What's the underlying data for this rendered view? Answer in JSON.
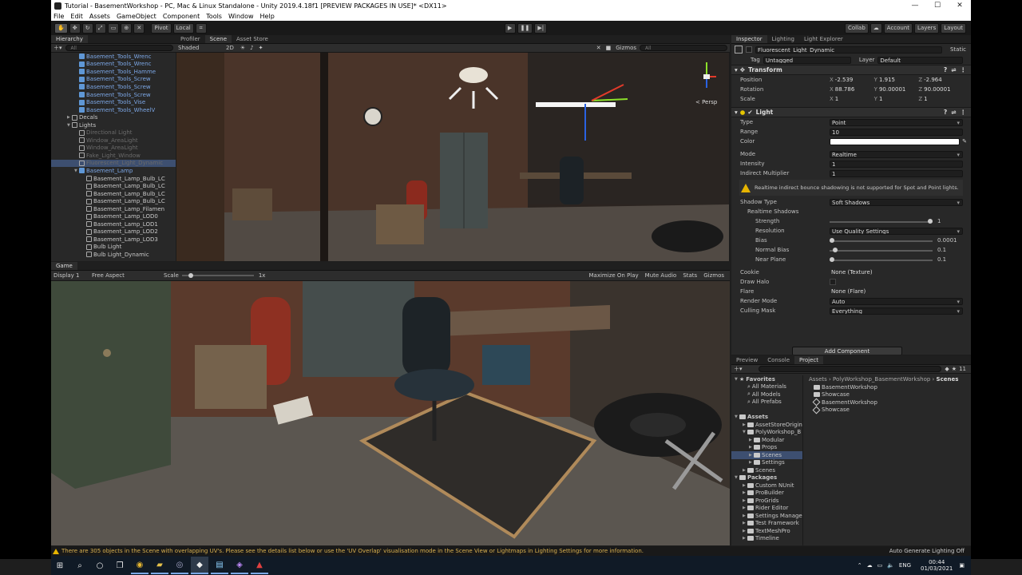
{
  "window": {
    "title": "Tutorial - BasementWorkshop - PC, Mac & Linux Standalone - Unity 2019.4.18f1 [PREVIEW PACKAGES IN USE]* <DX11>",
    "minimize": "—",
    "maximize": "☐",
    "close": "✕"
  },
  "menu": [
    "File",
    "Edit",
    "Assets",
    "GameObject",
    "Component",
    "Tools",
    "Window",
    "Help"
  ],
  "toolbar": {
    "pivot": "Pivot",
    "local": "Local",
    "collab": "Collab",
    "account": "Account",
    "layers": "Layers",
    "layout": "Layout"
  },
  "hierarchy": {
    "tab": "Hierarchy",
    "search_placeholder": "All",
    "items": [
      {
        "label": "Basement_Tools_Wrenc",
        "kind": "prefab",
        "indent": 3
      },
      {
        "label": "Basement_Tools_Wrenc",
        "kind": "prefab",
        "indent": 3
      },
      {
        "label": "Basement_Tools_Hamme",
        "kind": "prefab",
        "indent": 3
      },
      {
        "label": "Basement_Tools_Screw",
        "kind": "prefab",
        "indent": 3
      },
      {
        "label": "Basement_Tools_Screw",
        "kind": "prefab",
        "indent": 3
      },
      {
        "label": "Basement_Tools_Screw",
        "kind": "prefab",
        "indent": 3
      },
      {
        "label": "Basement_Tools_Vise",
        "kind": "prefab",
        "indent": 3
      },
      {
        "label": "Basement_Tools_WheelV",
        "kind": "prefab",
        "indent": 3
      },
      {
        "label": "Decals",
        "kind": "normal",
        "indent": 2
      },
      {
        "label": "Lights",
        "kind": "normal",
        "indent": 2
      },
      {
        "label": "Directional Light",
        "kind": "dim",
        "indent": 3
      },
      {
        "label": "Window_AreaLight",
        "kind": "dim",
        "indent": 3
      },
      {
        "label": "Window_AreaLight",
        "kind": "dim",
        "indent": 3
      },
      {
        "label": "Fake_Light_Window",
        "kind": "dim",
        "indent": 3
      },
      {
        "label": "Fluorescent_Light_Dynamic",
        "kind": "selected",
        "indent": 3
      },
      {
        "label": "Basement_Lamp",
        "kind": "prefab",
        "indent": 3
      },
      {
        "label": "Basement_Lamp_Bulb_LC",
        "kind": "normal",
        "indent": 4
      },
      {
        "label": "Basement_Lamp_Bulb_LC",
        "kind": "normal",
        "indent": 4
      },
      {
        "label": "Basement_Lamp_Bulb_LC",
        "kind": "normal",
        "indent": 4
      },
      {
        "label": "Basement_Lamp_Bulb_LC",
        "kind": "normal",
        "indent": 4
      },
      {
        "label": "Basement_Lamp_Filamen",
        "kind": "normal",
        "indent": 4
      },
      {
        "label": "Basement_Lamp_LOD0",
        "kind": "normal",
        "indent": 4
      },
      {
        "label": "Basement_Lamp_LOD1",
        "kind": "normal",
        "indent": 4
      },
      {
        "label": "Basement_Lamp_LOD2",
        "kind": "normal",
        "indent": 4
      },
      {
        "label": "Basement_Lamp_LOD3",
        "kind": "normal",
        "indent": 4
      },
      {
        "label": "Bulb Light",
        "kind": "normal",
        "indent": 4
      },
      {
        "label": "Bulb Light_Dynamic",
        "kind": "normal",
        "indent": 4
      }
    ]
  },
  "scene": {
    "tabs": [
      "Profiler",
      "Scene",
      "Asset Store"
    ],
    "shading": "Shaded",
    "mode_2d": "2D",
    "gizmos": "Gizmos",
    "search_placeholder": "All",
    "persp": "< Persp"
  },
  "game": {
    "tab": "Game",
    "display": "Display 1",
    "aspect": "Free Aspect",
    "scale_label": "Scale",
    "scale_value": "1x",
    "maximize": "Maximize On Play",
    "mute": "Mute Audio",
    "stats": "Stats",
    "gizmos": "Gizmos"
  },
  "inspector": {
    "tabs": [
      "Inspector",
      "Lighting",
      "Light Explorer"
    ],
    "object_name": "Fluorescent_Light_Dynamic",
    "static_label": "Static",
    "tag_label": "Tag",
    "tag_value": "Untagged",
    "layer_label": "Layer",
    "layer_value": "Default",
    "transform": {
      "title": "Transform",
      "position_label": "Position",
      "position": [
        "-2.539",
        "1.915",
        "-2.964"
      ],
      "rotation_label": "Rotation",
      "rotation": [
        "88.786",
        "90.00001",
        "90.00001"
      ],
      "scale_label": "Scale",
      "scale": [
        "1",
        "1",
        "1"
      ]
    },
    "light": {
      "title": "Light",
      "type_label": "Type",
      "type": "Point",
      "range_label": "Range",
      "range": "10",
      "color_label": "Color",
      "color": "#ffffff",
      "mode_label": "Mode",
      "mode": "Realtime",
      "intensity_label": "Intensity",
      "intensity": "1",
      "indirect_label": "Indirect Multiplier",
      "indirect": "1",
      "warning": "Realtime indirect bounce shadowing is not supported for Spot and Point lights.",
      "shadow_type_label": "Shadow Type",
      "shadow_type": "Soft Shadows",
      "realtime_shadows_label": "Realtime Shadows",
      "strength_label": "Strength",
      "strength": "1",
      "resolution_label": "Resolution",
      "resolution": "Use Quality Settings",
      "bias_label": "Bias",
      "bias": "0.0001",
      "normal_bias_label": "Normal Bias",
      "normal_bias": "0.1",
      "near_plane_label": "Near Plane",
      "near_plane": "0.1",
      "cookie_label": "Cookie",
      "cookie": "None (Texture)",
      "draw_halo_label": "Draw Halo",
      "flare_label": "Flare",
      "flare": "None (Flare)",
      "render_mode_label": "Render Mode",
      "render_mode": "Auto",
      "culling_label": "Culling Mask",
      "culling": "Everything"
    },
    "add_component": "Add Component"
  },
  "project": {
    "tabs": [
      "Preview",
      "Console",
      "Project"
    ],
    "badge": "11",
    "tree": [
      {
        "label": "Favorites",
        "kind": "fav-head"
      },
      {
        "label": "All Materials",
        "kind": "fav"
      },
      {
        "label": "All Models",
        "kind": "fav"
      },
      {
        "label": "All Prefabs",
        "kind": "fav"
      },
      {
        "label": "",
        "kind": "gap"
      },
      {
        "label": "Assets",
        "kind": "head"
      },
      {
        "label": "AssetStoreOrigin",
        "kind": "l1"
      },
      {
        "label": "PolyWorkshop_B",
        "kind": "l1"
      },
      {
        "label": "Modular",
        "kind": "l2"
      },
      {
        "label": "Props",
        "kind": "l2"
      },
      {
        "label": "Scenes",
        "kind": "l2sel"
      },
      {
        "label": "Settings",
        "kind": "l2"
      },
      {
        "label": "Scenes",
        "kind": "l1"
      },
      {
        "label": "Packages",
        "kind": "head"
      },
      {
        "label": "Custom NUnit",
        "kind": "l1"
      },
      {
        "label": "ProBuilder",
        "kind": "l1"
      },
      {
        "label": "ProGrids",
        "kind": "l1"
      },
      {
        "label": "Rider Editor",
        "kind": "l1"
      },
      {
        "label": "Settings Manage",
        "kind": "l1"
      },
      {
        "label": "Test Framework",
        "kind": "l1"
      },
      {
        "label": "TextMeshPro",
        "kind": "l1"
      },
      {
        "label": "Timeline",
        "kind": "l1"
      }
    ],
    "breadcrumb": [
      "Assets",
      "PolyWorkshop_BasementWorkshop",
      "Scenes"
    ],
    "files": [
      {
        "label": "BasementWorkshop",
        "kind": "folder"
      },
      {
        "label": "Showcase",
        "kind": "folder"
      },
      {
        "label": "BasementWorkshop",
        "kind": "scene"
      },
      {
        "label": "Showcase",
        "kind": "scene"
      }
    ]
  },
  "status": {
    "message": "There are 305 objects in the Scene with overlapping UV's. Please see the details list below or use the 'UV Overlap' visualisation mode in the Scene View or Lightmaps in Lighting Settings for more information.",
    "right": "Auto Generate Lighting Off"
  },
  "taskbar": {
    "lang": "ENG",
    "time": "00:44",
    "date": "01/03/2021"
  }
}
